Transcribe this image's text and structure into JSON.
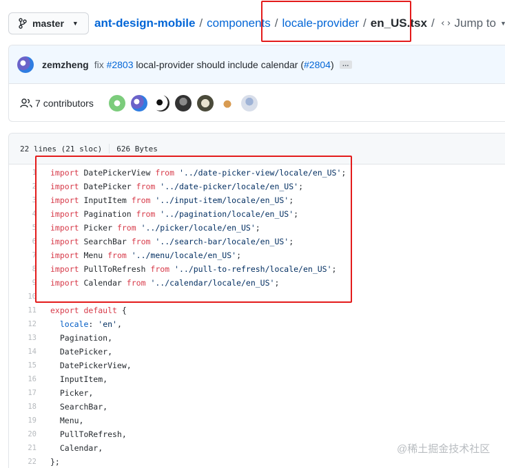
{
  "branch": {
    "label": "master"
  },
  "breadcrumb": {
    "repo": "ant-design-mobile",
    "sep": "/",
    "folder1": "components",
    "folder2": "locale-provider",
    "file": "en_US.tsx",
    "jump_label": "Jump to"
  },
  "commit": {
    "author": "zemzheng",
    "fix_word": "fix",
    "issue": "#2803",
    "message": "local-provider should include calendar",
    "paren_open": "(",
    "pr": "#2804",
    "paren_close": ")",
    "more": "…"
  },
  "contributors": {
    "count": "7",
    "label": "contributors"
  },
  "file_info": {
    "lines": "22 lines (21 sloc)",
    "size": "626 Bytes"
  },
  "code_lines": [
    {
      "num": "1",
      "parts": [
        [
          "kw",
          "import"
        ],
        [
          "plain",
          " DatePickerView "
        ],
        [
          "kw",
          "from"
        ],
        [
          "plain",
          " "
        ],
        [
          "str",
          "'../date-picker-view/locale/en_US'"
        ],
        [
          "plain",
          ";"
        ]
      ]
    },
    {
      "num": "2",
      "parts": [
        [
          "kw",
          "import"
        ],
        [
          "plain",
          " DatePicker "
        ],
        [
          "kw",
          "from"
        ],
        [
          "plain",
          " "
        ],
        [
          "str",
          "'../date-picker/locale/en_US'"
        ],
        [
          "plain",
          ";"
        ]
      ]
    },
    {
      "num": "3",
      "parts": [
        [
          "kw",
          "import"
        ],
        [
          "plain",
          " InputItem "
        ],
        [
          "kw",
          "from"
        ],
        [
          "plain",
          " "
        ],
        [
          "str",
          "'../input-item/locale/en_US'"
        ],
        [
          "plain",
          ";"
        ]
      ]
    },
    {
      "num": "4",
      "parts": [
        [
          "kw",
          "import"
        ],
        [
          "plain",
          " Pagination "
        ],
        [
          "kw",
          "from"
        ],
        [
          "plain",
          " "
        ],
        [
          "str",
          "'../pagination/locale/en_US'"
        ],
        [
          "plain",
          ";"
        ]
      ]
    },
    {
      "num": "5",
      "parts": [
        [
          "kw",
          "import"
        ],
        [
          "plain",
          " Picker "
        ],
        [
          "kw",
          "from"
        ],
        [
          "plain",
          " "
        ],
        [
          "str",
          "'../picker/locale/en_US'"
        ],
        [
          "plain",
          ";"
        ]
      ]
    },
    {
      "num": "6",
      "parts": [
        [
          "kw",
          "import"
        ],
        [
          "plain",
          " SearchBar "
        ],
        [
          "kw",
          "from"
        ],
        [
          "plain",
          " "
        ],
        [
          "str",
          "'../search-bar/locale/en_US'"
        ],
        [
          "plain",
          ";"
        ]
      ]
    },
    {
      "num": "7",
      "parts": [
        [
          "kw",
          "import"
        ],
        [
          "plain",
          " Menu "
        ],
        [
          "kw",
          "from"
        ],
        [
          "plain",
          " "
        ],
        [
          "str",
          "'../menu/locale/en_US'"
        ],
        [
          "plain",
          ";"
        ]
      ]
    },
    {
      "num": "8",
      "parts": [
        [
          "kw",
          "import"
        ],
        [
          "plain",
          " PullToRefresh "
        ],
        [
          "kw",
          "from"
        ],
        [
          "plain",
          " "
        ],
        [
          "str",
          "'../pull-to-refresh/locale/en_US'"
        ],
        [
          "plain",
          ";"
        ]
      ]
    },
    {
      "num": "9",
      "parts": [
        [
          "kw",
          "import"
        ],
        [
          "plain",
          " Calendar "
        ],
        [
          "kw",
          "from"
        ],
        [
          "plain",
          " "
        ],
        [
          "str",
          "'../calendar/locale/en_US'"
        ],
        [
          "plain",
          ";"
        ]
      ]
    },
    {
      "num": "10",
      "parts": []
    },
    {
      "num": "11",
      "parts": [
        [
          "kw",
          "export"
        ],
        [
          "plain",
          " "
        ],
        [
          "kw",
          "default"
        ],
        [
          "plain",
          " {"
        ]
      ]
    },
    {
      "num": "12",
      "parts": [
        [
          "plain",
          "  "
        ],
        [
          "prop",
          "locale"
        ],
        [
          "plain",
          ": "
        ],
        [
          "str",
          "'en'"
        ],
        [
          "plain",
          ","
        ]
      ]
    },
    {
      "num": "13",
      "parts": [
        [
          "plain",
          "  Pagination,"
        ]
      ]
    },
    {
      "num": "14",
      "parts": [
        [
          "plain",
          "  DatePicker,"
        ]
      ]
    },
    {
      "num": "15",
      "parts": [
        [
          "plain",
          "  DatePickerView,"
        ]
      ]
    },
    {
      "num": "16",
      "parts": [
        [
          "plain",
          "  InputItem,"
        ]
      ]
    },
    {
      "num": "17",
      "parts": [
        [
          "plain",
          "  Picker,"
        ]
      ]
    },
    {
      "num": "18",
      "parts": [
        [
          "plain",
          "  SearchBar,"
        ]
      ]
    },
    {
      "num": "19",
      "parts": [
        [
          "plain",
          "  Menu,"
        ]
      ]
    },
    {
      "num": "20",
      "parts": [
        [
          "plain",
          "  PullToRefresh,"
        ]
      ]
    },
    {
      "num": "21",
      "parts": [
        [
          "plain",
          "  Calendar,"
        ]
      ]
    },
    {
      "num": "22",
      "parts": [
        [
          "plain",
          "};"
        ]
      ]
    }
  ],
  "watermark": "@稀土掘金技术社区",
  "colors": {
    "highlight": "#e31a1a",
    "link": "#0366d6",
    "keyword": "#d73a49",
    "string": "#032f62"
  }
}
